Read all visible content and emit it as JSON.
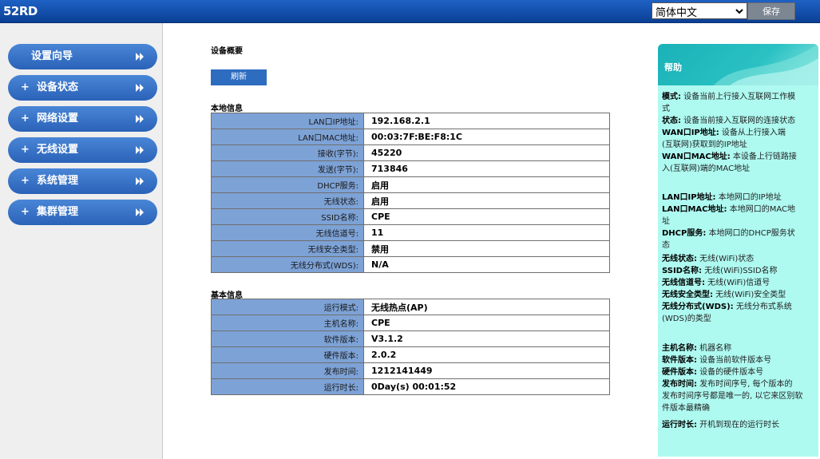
{
  "header": {
    "logo": "52RD",
    "language": "简体中文",
    "save_label": "保存"
  },
  "sidebar": {
    "items": [
      {
        "prefix": "",
        "label": "设置向导"
      },
      {
        "prefix": "+",
        "label": "设备状态"
      },
      {
        "prefix": "+",
        "label": "网络设置"
      },
      {
        "prefix": "+",
        "label": "无线设置"
      },
      {
        "prefix": "+",
        "label": "系统管理"
      },
      {
        "prefix": "+",
        "label": "集群管理"
      }
    ]
  },
  "main": {
    "page_title": "设备概要",
    "refresh_label": "刷新",
    "local_section": {
      "title": "本地信息",
      "rows": [
        {
          "label": "LAN口IP地址:",
          "value": "192.168.2.1"
        },
        {
          "label": "LAN口MAC地址:",
          "value": "00:03:7F:BE:F8:1C"
        },
        {
          "label": "接收(字节):",
          "value": "45220"
        },
        {
          "label": "发送(字节):",
          "value": "713846"
        },
        {
          "label": "DHCP服务:",
          "value": "启用"
        },
        {
          "label": "无线状态:",
          "value": "启用"
        },
        {
          "label": "SSID名称:",
          "value": "CPE"
        },
        {
          "label": "无线信道号:",
          "value": "11"
        },
        {
          "label": "无线安全类型:",
          "value": "禁用"
        },
        {
          "label": "无线分布式(WDS):",
          "value": "N/A"
        }
      ]
    },
    "basic_section": {
      "title": "基本信息",
      "rows": [
        {
          "label": "运行模式:",
          "value": "无线热点(AP)"
        },
        {
          "label": "主机名称:",
          "value": "CPE"
        },
        {
          "label": "软件版本:",
          "value": "V3.1.2"
        },
        {
          "label": "硬件版本:",
          "value": "2.0.2"
        },
        {
          "label": "发布时间:",
          "value": "1212141449"
        },
        {
          "label": "运行时长:",
          "value": "0Day(s) 00:01:52"
        }
      ]
    }
  },
  "help": {
    "title": "帮助",
    "lines": [
      {
        "term": "模式:",
        "desc": " 设备当前上行接入互联网工作模"
      },
      {
        "term": "",
        "desc": "式"
      },
      {
        "term": "状态:",
        "desc": " 设备当前接入互联网的连接状态"
      },
      {
        "term": "WAN口IP地址:",
        "desc": " 设备从上行接入端"
      },
      {
        "term": "",
        "desc": "(互联网)获取到的IP地址"
      },
      {
        "term": "WAN口MAC地址:",
        "desc": " 本设备上行链路接"
      },
      {
        "term": "",
        "desc": "入(互联网)端的MAC地址"
      },
      {
        "term": "LAN口IP地址:",
        "desc": " 本地网口的IP地址"
      },
      {
        "term": "LAN口MAC地址:",
        "desc": " 本地网口的MAC地"
      },
      {
        "term": "",
        "desc": "址"
      },
      {
        "term": "DHCP服务:",
        "desc": " 本地网口的DHCP服务状"
      },
      {
        "term": "",
        "desc": "态"
      },
      {
        "term": "无线状态:",
        "desc": " 无线(WiFi)状态"
      },
      {
        "term": "SSID名称:",
        "desc": " 无线(WiFi)SSID名称"
      },
      {
        "term": "无线信道号:",
        "desc": " 无线(WiFi)信道号"
      },
      {
        "term": "无线安全类型:",
        "desc": " 无线(WiFi)安全类型"
      },
      {
        "term": "无线分布式(WDS):",
        "desc": " 无线分布式系统"
      },
      {
        "term": "",
        "desc": "(WDS)的类型"
      },
      {
        "term": "主机名称:",
        "desc": " 机器名称"
      },
      {
        "term": "软件版本:",
        "desc": " 设备当前软件版本号"
      },
      {
        "term": "硬件版本:",
        "desc": " 设备的硬件版本号"
      },
      {
        "term": "发布时间:",
        "desc": " 发布时间序号, 每个版本的"
      },
      {
        "term": "",
        "desc": "发布时间序号都是唯一的, 以它来区别软"
      },
      {
        "term": "",
        "desc": "件版本最精确"
      },
      {
        "term": "运行时长:",
        "desc": " 开机到现在的运行时长"
      }
    ]
  },
  "colors": {
    "header": "#0a3f95",
    "nav": "#2a62b8",
    "label_cell": "#7da2d6",
    "help_bg": "#aefaf1",
    "help_header": "#1ab2b8"
  }
}
